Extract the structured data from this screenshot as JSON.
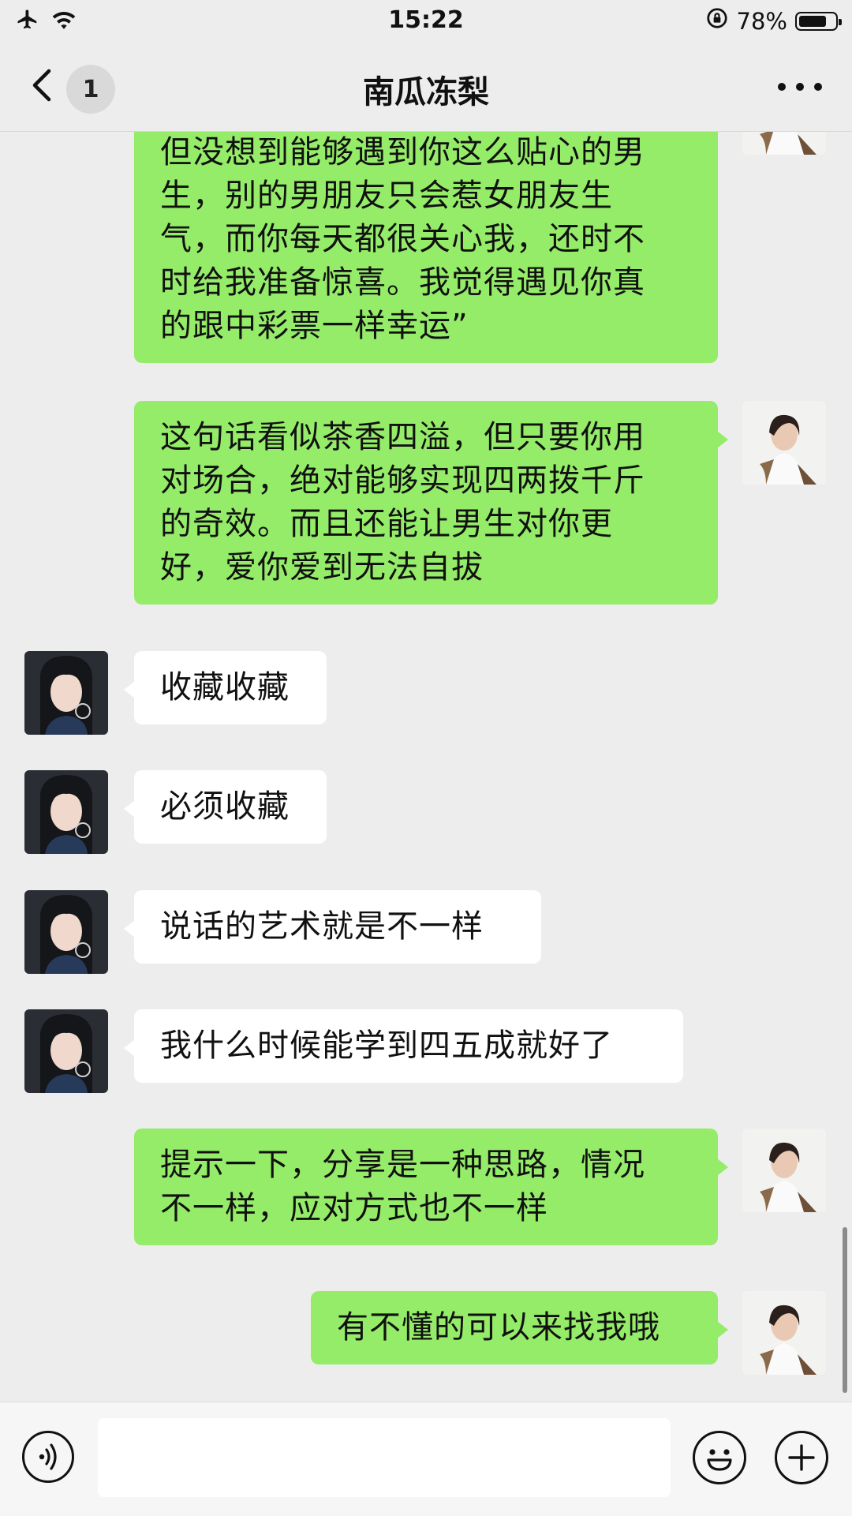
{
  "status_bar": {
    "time": "15:22",
    "battery_percent": "78%",
    "battery_level": 0.78,
    "icons": [
      "airplane-icon",
      "wifi-icon",
      "rotation-lock-icon",
      "battery-icon"
    ]
  },
  "nav": {
    "title": "南瓜冻梨",
    "unread_count": "1",
    "back_icon": "chevron-left-icon",
    "more_icon": "more-icon"
  },
  "messages": [
    {
      "sender": "me",
      "lines": [
        "但没想到能够遇到你这么贴心的男",
        "生，别的男朋友只会惹女朋友生",
        "气，而你每天都很关心我，还时不",
        "时给我准备惊喜。我觉得遇见你真",
        "的跟中彩票一样幸运”"
      ]
    },
    {
      "sender": "me",
      "lines": [
        "这句话看似茶香四溢，但只要你用",
        "对场合，绝对能够实现四两拨千斤",
        "的奇效。而且还能让男生对你更",
        "好，爱你爱到无法自拔"
      ]
    },
    {
      "sender": "them",
      "lines": [
        "收藏收藏"
      ]
    },
    {
      "sender": "them",
      "lines": [
        "必须收藏"
      ]
    },
    {
      "sender": "them",
      "lines": [
        "说话的艺术就是不一样"
      ]
    },
    {
      "sender": "them",
      "lines": [
        "我什么时候能学到四五成就好了"
      ]
    },
    {
      "sender": "me",
      "lines": [
        "提示一下，分享是一种思路，情况",
        "不一样，应对方式也不一样"
      ]
    },
    {
      "sender": "me",
      "lines": [
        "有不懂的可以来找我哦"
      ]
    }
  ],
  "input_bar": {
    "voice_icon": "voice-icon",
    "text_value": "",
    "emoji_icon": "emoji-icon",
    "plus_icon": "plus-icon"
  },
  "colors": {
    "background": "#ededed",
    "my_bubble": "#95ec69",
    "their_bubble": "#ffffff"
  }
}
